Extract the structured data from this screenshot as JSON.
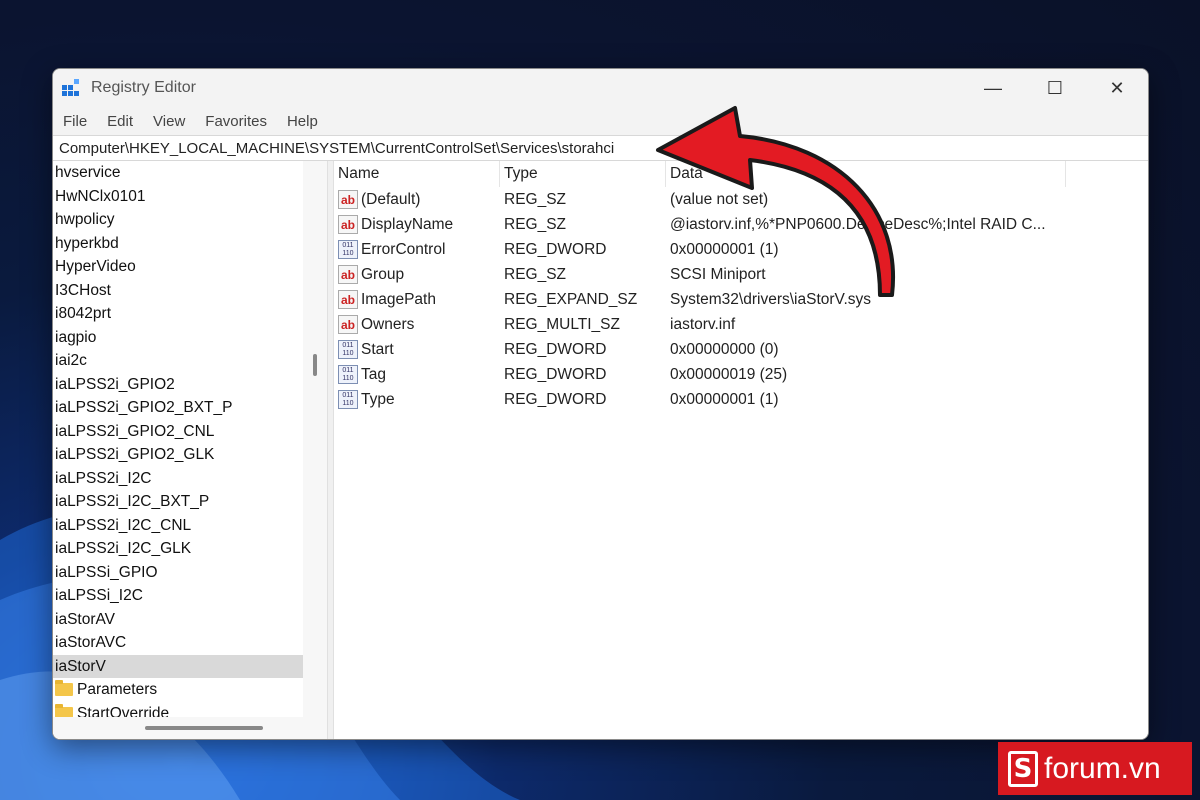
{
  "window": {
    "title": "Registry Editor",
    "controls": {
      "minimize": "—",
      "maximize": "☐",
      "close": "✕"
    }
  },
  "menu": [
    "File",
    "Edit",
    "View",
    "Favorites",
    "Help"
  ],
  "address": "Computer\\HKEY_LOCAL_MACHINE\\SYSTEM\\CurrentControlSet\\Services\\storahci",
  "tree": {
    "items": [
      "hvservice",
      "HwNClx0101",
      "hwpolicy",
      "hyperkbd",
      "HyperVideo",
      "I3CHost",
      "i8042prt",
      "iagpio",
      "iai2c",
      "iaLPSS2i_GPIO2",
      "iaLPSS2i_GPIO2_BXT_P",
      "iaLPSS2i_GPIO2_CNL",
      "iaLPSS2i_GPIO2_GLK",
      "iaLPSS2i_I2C",
      "iaLPSS2i_I2C_BXT_P",
      "iaLPSS2i_I2C_CNL",
      "iaLPSS2i_I2C_GLK",
      "iaLPSSi_GPIO",
      "iaLPSSi_I2C",
      "iaStorAV",
      "iaStorAVC",
      "iaStorV"
    ],
    "selected": "iaStorV",
    "children": [
      "Parameters",
      "StartOverride"
    ]
  },
  "values": {
    "headers": {
      "name": "Name",
      "type": "Type",
      "data": "Data"
    },
    "rows": [
      {
        "icon": "string-value-icon",
        "name": "(Default)",
        "type": "REG_SZ",
        "data": "(value not set)"
      },
      {
        "icon": "string-value-icon",
        "name": "DisplayName",
        "type": "REG_SZ",
        "data": "@iastorv.inf,%*PNP0600.DeviceDesc%;Intel RAID C..."
      },
      {
        "icon": "binary-value-icon",
        "name": "ErrorControl",
        "type": "REG_DWORD",
        "data": "0x00000001 (1)"
      },
      {
        "icon": "string-value-icon",
        "name": "Group",
        "type": "REG_SZ",
        "data": "SCSI Miniport"
      },
      {
        "icon": "string-value-icon",
        "name": "ImagePath",
        "type": "REG_EXPAND_SZ",
        "data": "System32\\drivers\\iaStorV.sys"
      },
      {
        "icon": "string-value-icon",
        "name": "Owners",
        "type": "REG_MULTI_SZ",
        "data": "iastorv.inf"
      },
      {
        "icon": "binary-value-icon",
        "name": "Start",
        "type": "REG_DWORD",
        "data": "0x00000000 (0)"
      },
      {
        "icon": "binary-value-icon",
        "name": "Tag",
        "type": "REG_DWORD",
        "data": "0x00000019 (25)"
      },
      {
        "icon": "binary-value-icon",
        "name": "Type",
        "type": "REG_DWORD",
        "data": "0x00000001 (1)"
      }
    ]
  },
  "icons": {
    "string": "ab",
    "dword_top": "011",
    "dword_bottom": "110"
  },
  "annotation": {
    "arrow_color": "#e31b23"
  },
  "watermark": {
    "mark": "S",
    "text": "forum.vn",
    "color": "#d71920"
  }
}
